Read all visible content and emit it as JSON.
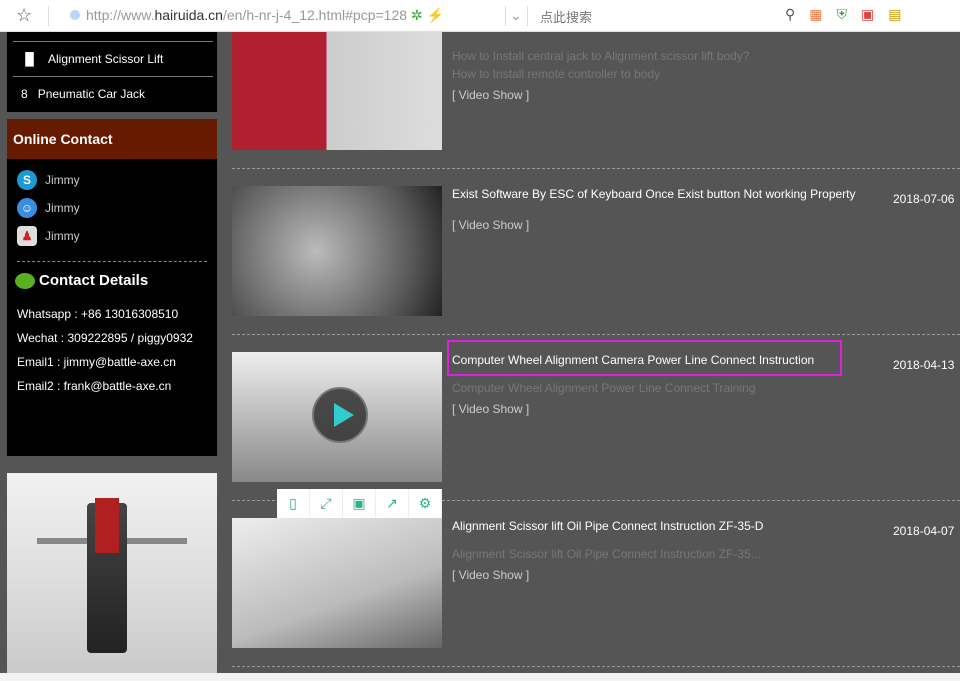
{
  "browser": {
    "url_prefix": "http://www.",
    "url_domain": "hairuida.cn",
    "url_rest": "/en/h-nr-j-4_12.html#pcp=128",
    "search_placeholder": "点此搜索"
  },
  "sidebar": {
    "nav": [
      {
        "label": "Alignment Scissor Lift"
      },
      {
        "label": "Pneumatic Car Jack"
      }
    ],
    "online_contact_title": "Online Contact",
    "contacts": [
      {
        "icon": "skype-icon",
        "name": "Jimmy"
      },
      {
        "icon": "messenger-icon",
        "name": "Jimmy"
      },
      {
        "icon": "qq-icon",
        "name": "Jimmy"
      }
    ],
    "contact_details_title": "Contact Details",
    "details": [
      "Whatsapp : +86 13016308510",
      "Wechat : 309222895 / piggy0932",
      "Email1 : jimmy@battle-axe.cn",
      "Email2 : frank@battle-axe.cn"
    ]
  },
  "videos": [
    {
      "title": "",
      "subs": [
        "How to Install central jack to Alignment scissor lift body?",
        "How to Install remote controller to body"
      ],
      "link": "[ Video Show ]",
      "date": ""
    },
    {
      "title": "Exist Software By ESC of Keyboard Once Exist button Not working Property",
      "subs": [],
      "link": "[ Video Show ]",
      "date": "2018-07-06"
    },
    {
      "title": "Computer Wheel Alignment Camera Power Line Connect Instruction",
      "subs": [
        "Computer Wheel Alignment Power Line Connect Training"
      ],
      "link": "[ Video Show ]",
      "date": "2018-04-13"
    },
    {
      "title": "Alignment Scissor lift Oil Pipe Connect Instruction ZF-35-D",
      "subs": [
        "Alignment Scissor lift Oil Pipe Connect Instruction ZF-35..."
      ],
      "link": "[ Video Show ]",
      "date": "2018-04-07"
    }
  ],
  "accent": "#e020e0"
}
